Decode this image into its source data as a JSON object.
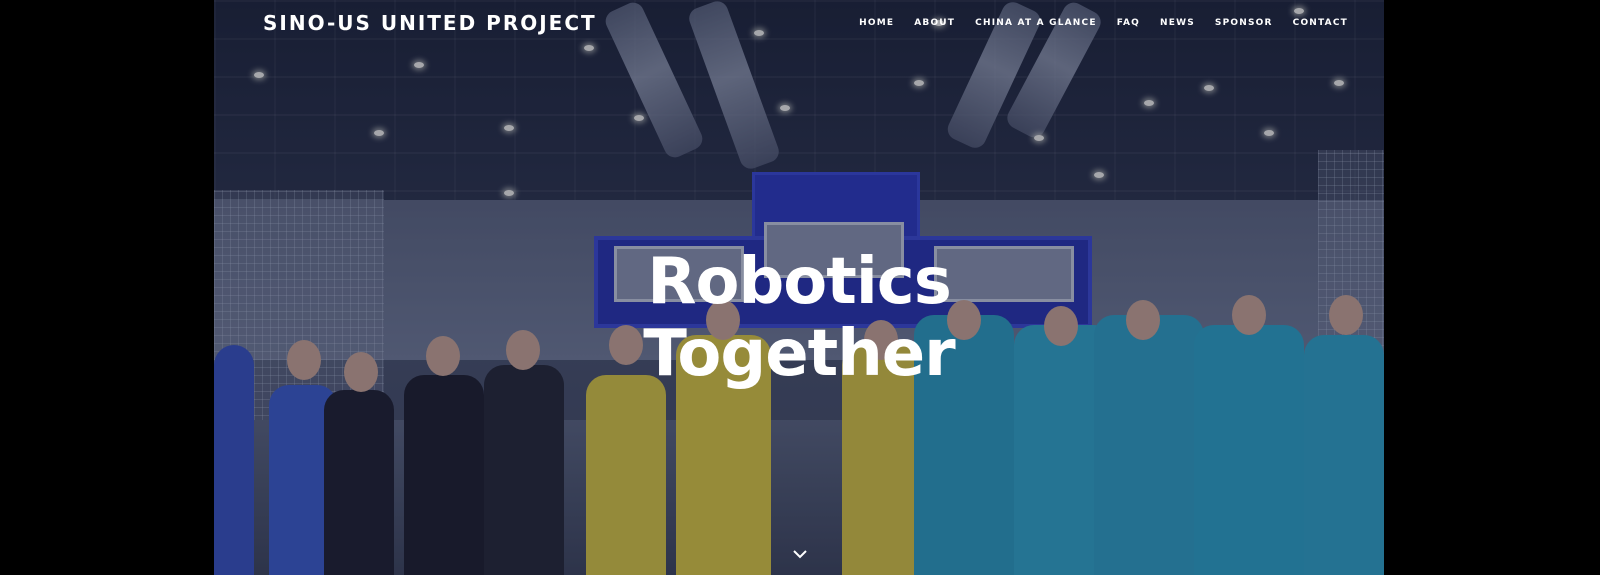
{
  "header": {
    "site_title": "SINO-US UNITED PROJECT"
  },
  "nav": {
    "items": [
      {
        "label": "HOME"
      },
      {
        "label": "ABOUT"
      },
      {
        "label": "CHINA AT A GLANCE"
      },
      {
        "label": "FAQ"
      },
      {
        "label": "NEWS"
      },
      {
        "label": "SPONSOR"
      },
      {
        "label": "CONTACT"
      }
    ]
  },
  "hero": {
    "headline_line1": "Robotics",
    "headline_line2": "Together",
    "scroll_icon": "chevron-down-icon"
  },
  "colors": {
    "background": "#000000",
    "text": "#ffffff",
    "overlay": "#141a3c"
  }
}
